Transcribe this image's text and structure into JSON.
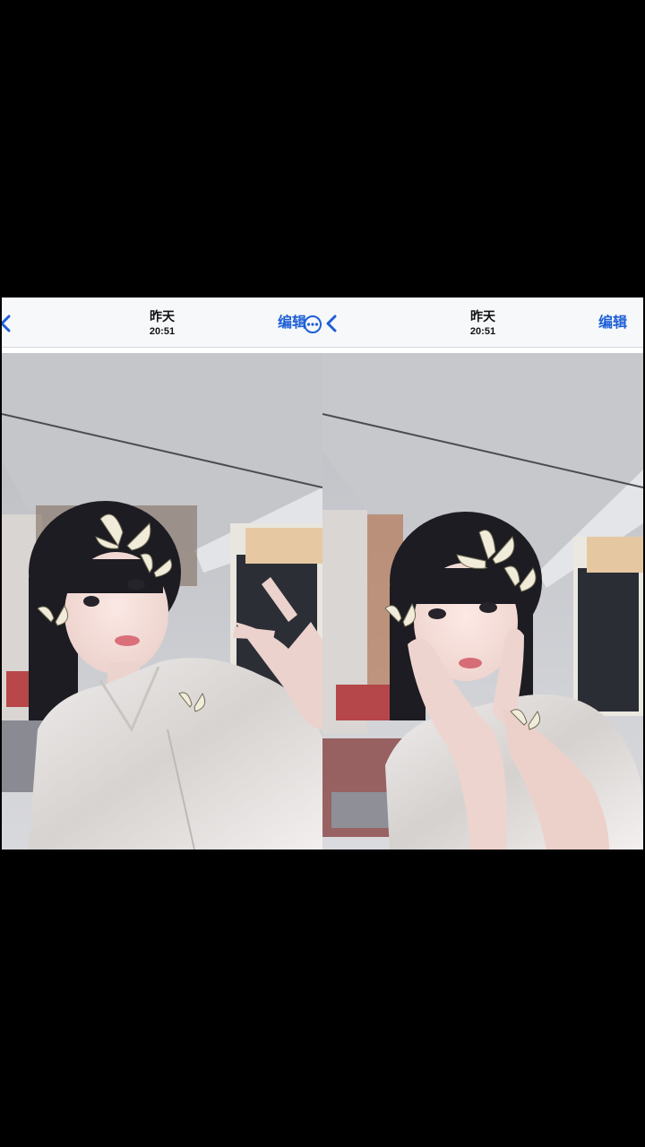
{
  "screenshots": [
    {
      "nav": {
        "title": "昨天",
        "time": "20:51",
        "edit_label": "编辑"
      }
    },
    {
      "nav": {
        "title": "昨天",
        "time": "20:51",
        "edit_label": "编辑"
      }
    }
  ],
  "icons": {
    "back": "chevron-left-icon",
    "more": "more-circle-icon"
  },
  "colors": {
    "accent": "#1d5fd6",
    "background": "#000000",
    "navbar": "#f7f8fa"
  }
}
